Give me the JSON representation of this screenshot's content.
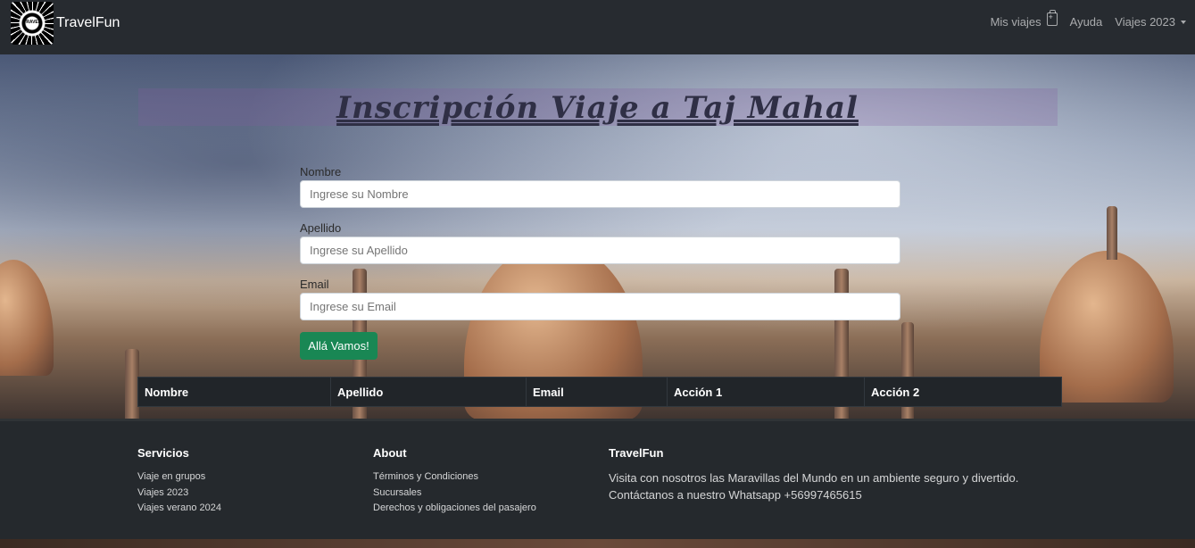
{
  "navbar": {
    "brand": "TravelFun",
    "logo_text": "TRAVEL",
    "links": [
      {
        "label": "Mis viajes",
        "icon": "suitcase-plus-icon"
      },
      {
        "label": "Ayuda"
      },
      {
        "label": "Viajes 2023",
        "icon": "caret-down-icon"
      }
    ]
  },
  "hero": {
    "title": "Inscripción Viaje a Taj Mahal"
  },
  "form": {
    "fields": [
      {
        "label": "Nombre",
        "placeholder": "Ingrese su Nombre"
      },
      {
        "label": "Apellido",
        "placeholder": "Ingrese su Apellido"
      },
      {
        "label": "Email",
        "placeholder": "Ingrese su Email"
      }
    ],
    "submit_label": "Allá Vamos!"
  },
  "table": {
    "headers": [
      "Nombre",
      "Apellido",
      "Email",
      "Acción 1",
      "Acción 2"
    ]
  },
  "footer": {
    "servicios": {
      "title": "Servicios",
      "items": [
        "Viaje en grupos",
        "Viajes 2023",
        "Viajes verano 2024"
      ]
    },
    "about": {
      "title": "About",
      "items": [
        "Términos y Condiciones",
        "Sucursales",
        "Derechos y obligaciones del pasajero"
      ]
    },
    "travelfun": {
      "title": "TravelFun",
      "lines": [
        "Visita con nosotros las Maravillas del Mundo en un ambiente seguro y divertido.",
        "Contáctanos a nuestro Whatsapp +56997465615"
      ]
    }
  },
  "colors": {
    "navbar_bg": "#272b30",
    "success": "#198754",
    "table_bg": "#212529"
  }
}
